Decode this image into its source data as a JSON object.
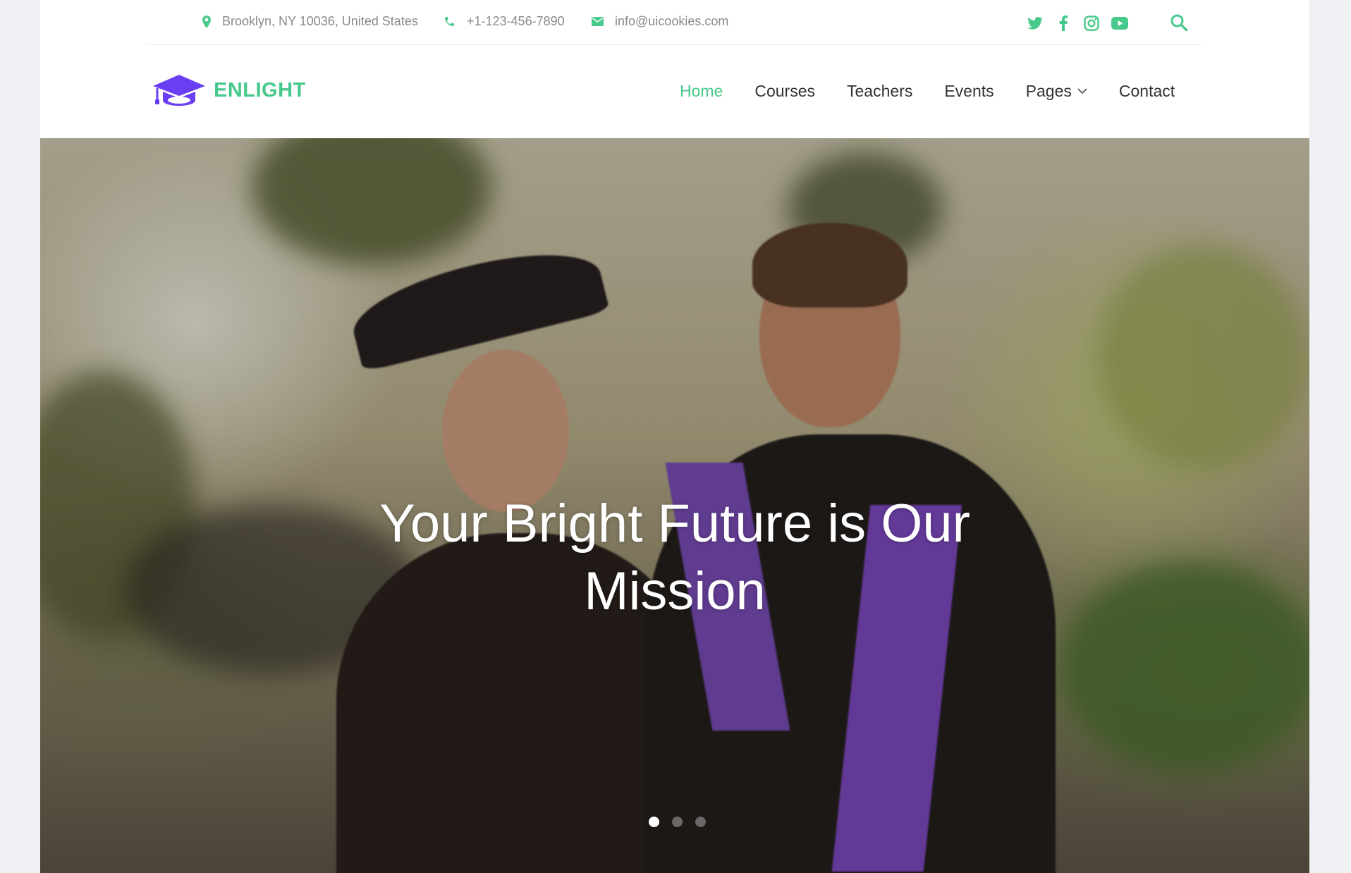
{
  "topbar": {
    "address": "Brooklyn, NY 10036, United States",
    "phone": "+1-123-456-7890",
    "email": "info@uicookies.com",
    "socials": [
      "twitter-icon",
      "facebook-icon",
      "instagram-icon",
      "youtube-icon"
    ],
    "accent": "#46c98b"
  },
  "header": {
    "logo_text": "ENLIGHT",
    "logo_icon_color": "#6a3ff3",
    "nav": [
      {
        "label": "Home",
        "active": true
      },
      {
        "label": "Courses"
      },
      {
        "label": "Teachers"
      },
      {
        "label": "Events"
      },
      {
        "label": "Pages",
        "has_dropdown": true
      },
      {
        "label": "Contact"
      }
    ]
  },
  "hero": {
    "title": "Your Bright Future is Our Mission",
    "slides": 3,
    "active_slide": 1
  }
}
